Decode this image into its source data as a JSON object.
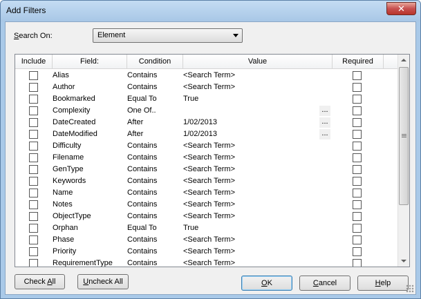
{
  "window": {
    "title": "Add Filters",
    "close_glyph": "✕"
  },
  "search": {
    "label_pre": "",
    "label_accel": "S",
    "label_post": "earch On:",
    "selected": "Element"
  },
  "columns": {
    "include": "Include",
    "field": "Field:",
    "condition": "Condition",
    "value": "Value",
    "required": "Required"
  },
  "rows": [
    {
      "field": "Alias",
      "condition": "Contains",
      "value": "<Search Term>",
      "ellipsis": ""
    },
    {
      "field": "Author",
      "condition": "Contains",
      "value": "<Search Term>",
      "ellipsis": ""
    },
    {
      "field": "Bookmarked",
      "condition": "Equal To",
      "value": "True",
      "ellipsis": ""
    },
    {
      "field": "Complexity",
      "condition": "One Of..",
      "value": "",
      "ellipsis": "..."
    },
    {
      "field": "DateCreated",
      "condition": "After",
      "value": "1/02/2013",
      "ellipsis": "..."
    },
    {
      "field": "DateModified",
      "condition": "After",
      "value": "1/02/2013",
      "ellipsis": "..."
    },
    {
      "field": "Difficulty",
      "condition": "Contains",
      "value": "<Search Term>",
      "ellipsis": ""
    },
    {
      "field": "Filename",
      "condition": "Contains",
      "value": "<Search Term>",
      "ellipsis": ""
    },
    {
      "field": "GenType",
      "condition": "Contains",
      "value": "<Search Term>",
      "ellipsis": ""
    },
    {
      "field": "Keywords",
      "condition": "Contains",
      "value": "<Search Term>",
      "ellipsis": ""
    },
    {
      "field": "Name",
      "condition": "Contains",
      "value": "<Search Term>",
      "ellipsis": ""
    },
    {
      "field": "Notes",
      "condition": "Contains",
      "value": "<Search Term>",
      "ellipsis": ""
    },
    {
      "field": "ObjectType",
      "condition": "Contains",
      "value": "<Search Term>",
      "ellipsis": ""
    },
    {
      "field": "Orphan",
      "condition": "Equal To",
      "value": "True",
      "ellipsis": ""
    },
    {
      "field": "Phase",
      "condition": "Contains",
      "value": "<Search Term>",
      "ellipsis": ""
    },
    {
      "field": "Priority",
      "condition": "Contains",
      "value": "<Search Term>",
      "ellipsis": ""
    },
    {
      "field": "RequirementType",
      "condition": "Contains",
      "value": "<Search Term>",
      "ellipsis": ""
    }
  ],
  "buttons": {
    "check_all_pre": "Check ",
    "check_all_accel": "A",
    "check_all_post": "ll",
    "uncheck_all_pre": "",
    "uncheck_all_accel": "U",
    "uncheck_all_post": "ncheck All",
    "ok_pre": "",
    "ok_accel": "O",
    "ok_post": "K",
    "cancel_pre": "",
    "cancel_accel": "C",
    "cancel_post": "ancel",
    "help_pre": "",
    "help_accel": "H",
    "help_post": "elp"
  }
}
